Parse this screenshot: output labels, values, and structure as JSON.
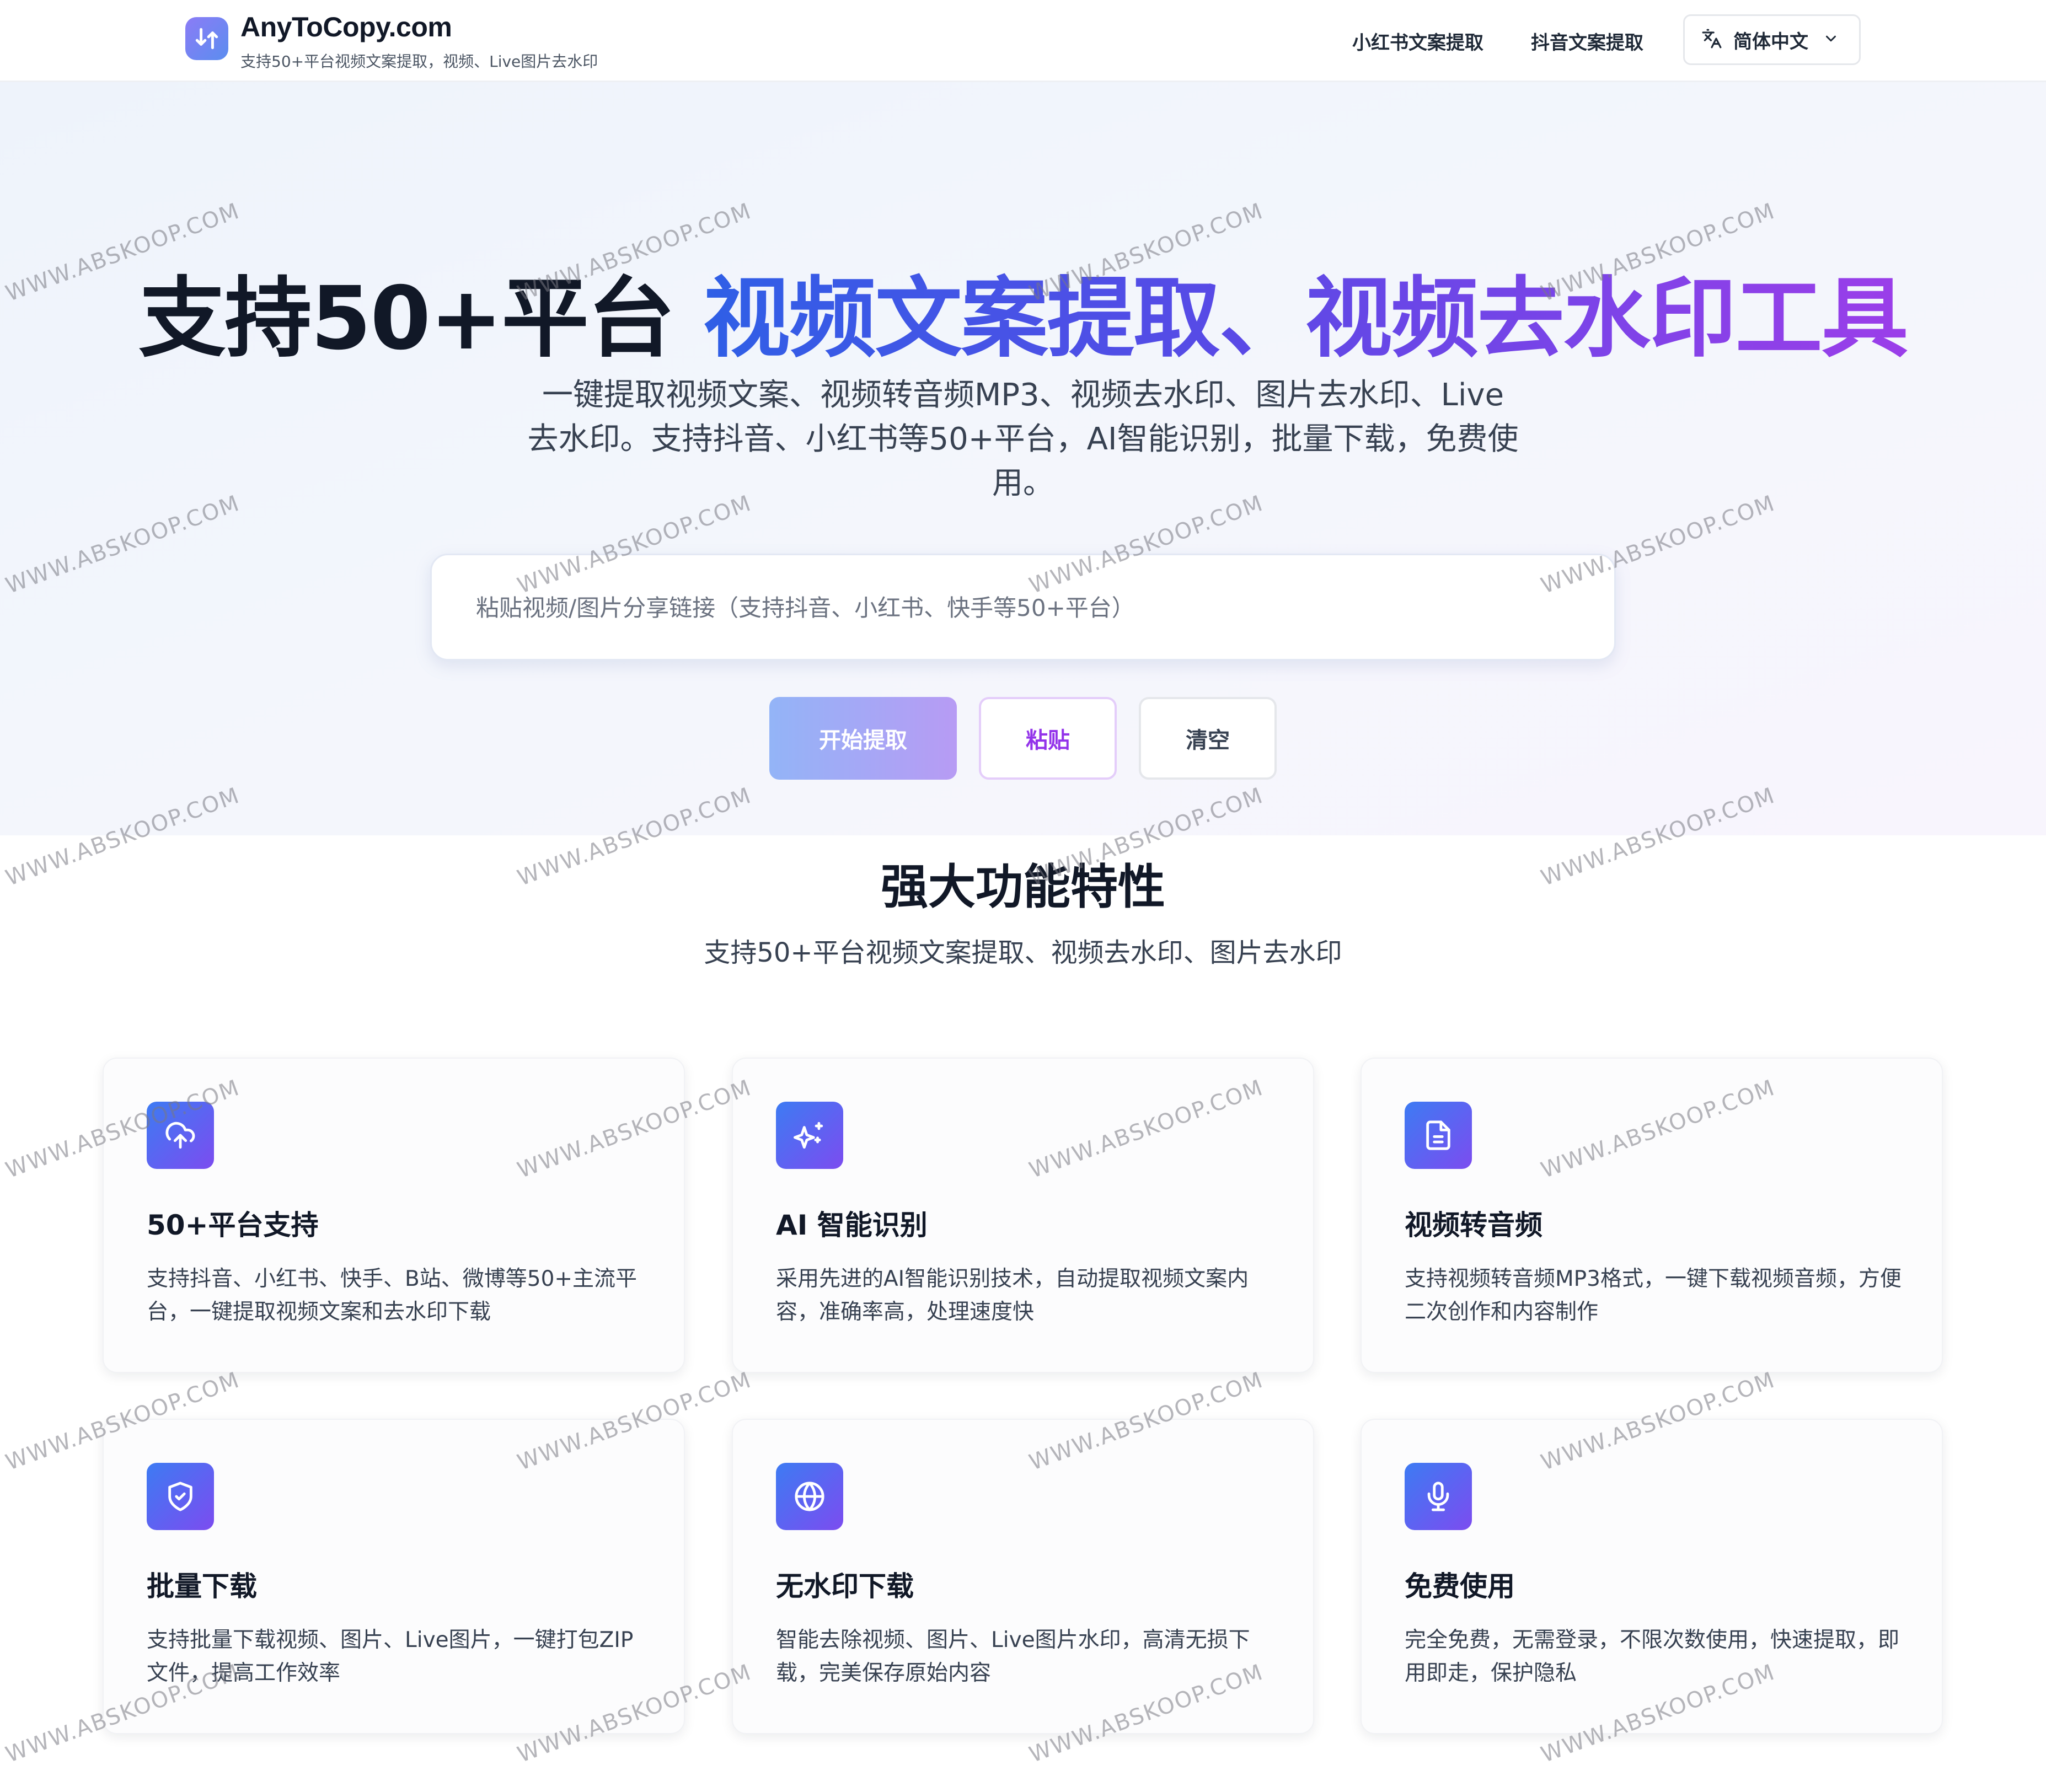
{
  "header": {
    "brand_name": "AnyToCopy.com",
    "brand_tagline": "支持50+平台视频文案提取，视频、Live图片去水印",
    "nav": [
      {
        "label": "小红书文案提取"
      },
      {
        "label": "抖音文案提取"
      }
    ],
    "language": {
      "label": "简体中文",
      "icon": "translate-icon"
    }
  },
  "hero": {
    "title_plain": "支持50+平台",
    "title_highlight": "视频文案提取、视频去水印工具",
    "subtitle": "一键提取视频文案、视频转音频MP3、视频去水印、图片去水印、Live去水印。支持抖音、小红书等50+平台，AI智能识别，批量下载，免费使用。",
    "search": {
      "placeholder": "粘贴视频/图片分享链接（支持抖音、小红书、快手等50+平台）",
      "value": ""
    },
    "buttons": {
      "start": "开始提取",
      "paste": "粘贴",
      "clear": "清空"
    }
  },
  "features": {
    "title": "强大功能特性",
    "subtitle": "支持50+平台视频文案提取、视频去水印、图片去水印",
    "cards": [
      {
        "icon": "cloud-upload-icon",
        "title": "50+平台支持",
        "desc": "支持抖音、小红书、快手、B站、微博等50+主流平台，一键提取视频文案和去水印下载"
      },
      {
        "icon": "sparkles-icon",
        "title": "AI 智能识别",
        "desc": "采用先进的AI智能识别技术，自动提取视频文案内容，准确率高，处理速度快"
      },
      {
        "icon": "document-icon",
        "title": "视频转音频",
        "desc": "支持视频转音频MP3格式，一键下载视频音频，方便二次创作和内容制作"
      },
      {
        "icon": "shield-check-icon",
        "title": "批量下载",
        "desc": "支持批量下载视频、图片、Live图片，一键打包ZIP文件，提高工作效率"
      },
      {
        "icon": "globe-icon",
        "title": "无水印下载",
        "desc": "智能去除视频、图片、Live图片水印，高清无损下载，完美保存原始内容"
      },
      {
        "icon": "microphone-icon",
        "title": "免费使用",
        "desc": "完全免费，无需登录，不限次数使用，快速提取，即用即走，保护隐私"
      }
    ]
  },
  "watermark": {
    "text": "WWW.ABSKOOP.COM"
  },
  "colors": {
    "accent_blue": "#2f5fe6",
    "accent_purple": "#9b3ee9",
    "paste_text": "#9333ea",
    "icon_gradient_start": "#3d7bf3",
    "icon_gradient_end": "#7c4cf0"
  }
}
